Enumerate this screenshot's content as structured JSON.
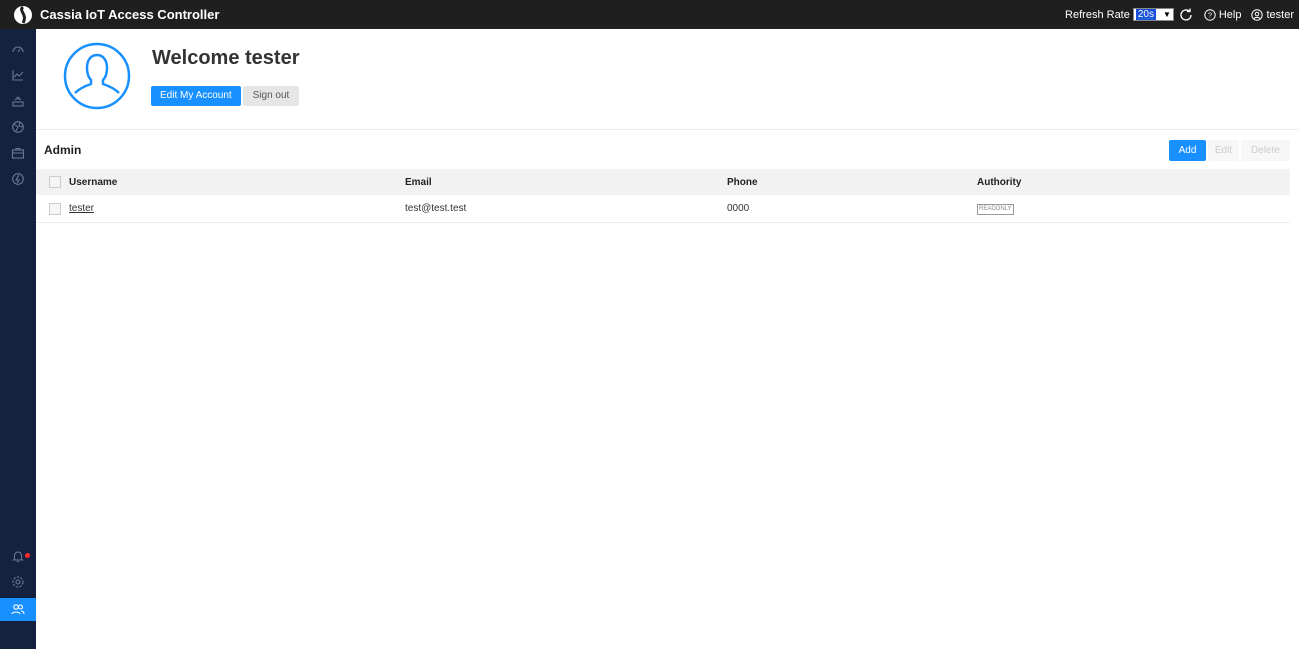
{
  "header": {
    "app_title": "Cassia IoT Access Controller",
    "refresh_label": "Refresh Rate",
    "refresh_value": "20s",
    "help_label": "Help",
    "user_label": "tester"
  },
  "sidebar": {
    "items": [
      {
        "icon": "dashboard-icon"
      },
      {
        "icon": "chart-icon"
      },
      {
        "icon": "router-icon"
      },
      {
        "icon": "globe-icon"
      },
      {
        "icon": "toolbox-icon"
      },
      {
        "icon": "location-icon"
      },
      {
        "icon": "bell-icon",
        "notification": true
      },
      {
        "icon": "gear-icon"
      },
      {
        "icon": "users-icon",
        "active": true
      }
    ]
  },
  "profile": {
    "welcome": "Welcome tester",
    "edit_button": "Edit My Account",
    "signout_button": "Sign out"
  },
  "admin": {
    "title": "Admin",
    "add_button": "Add",
    "edit_button": "Edit",
    "delete_button": "Delete",
    "columns": [
      "Username",
      "Email",
      "Phone",
      "Authority"
    ],
    "rows": [
      {
        "username": "tester",
        "email": "test@test.test",
        "phone": "0000",
        "authority": "READONLY"
      }
    ]
  },
  "colors": {
    "accent": "#1890ff",
    "sidebar_bg": "#14213f",
    "topbar_bg": "#1f1f1f",
    "notification": "#ff2b2b"
  }
}
